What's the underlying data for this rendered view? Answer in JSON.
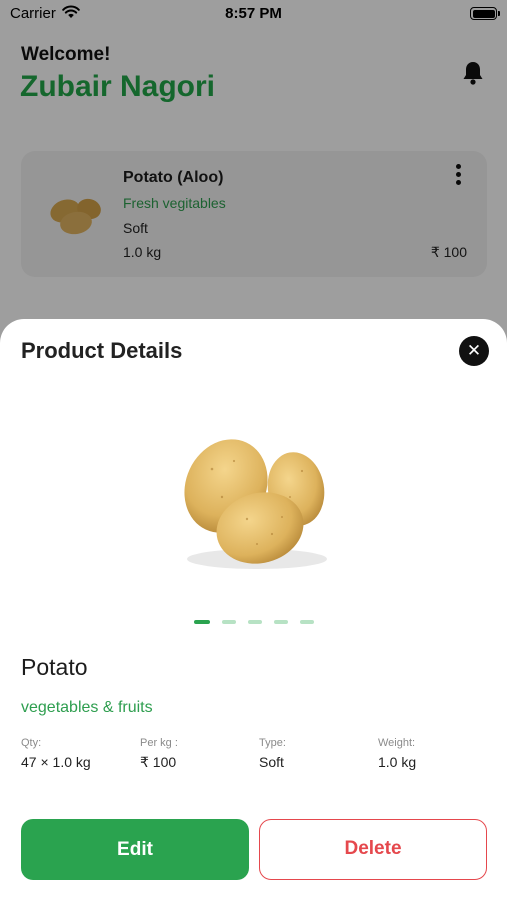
{
  "status_bar": {
    "carrier": "Carrier",
    "time": "8:57 PM"
  },
  "header": {
    "greeting": "Welcome!",
    "user_name": "Zubair Nagori",
    "notification_icon": "bell-icon"
  },
  "product_card": {
    "title": "Potato (Aloo)",
    "category": "Fresh vegitables",
    "type": "Soft",
    "weight": "1.0 kg",
    "price": "₹ 100",
    "menu_icon": "more-vertical-icon"
  },
  "details_sheet": {
    "title": "Product Details",
    "close_icon": "close-icon",
    "carousel": {
      "count": 5,
      "active_index": 0
    },
    "product_name": "Potato",
    "category": "vegetables & fruits",
    "details": [
      {
        "label": "Qty:",
        "value": "47 × 1.0 kg"
      },
      {
        "label": "Per kg :",
        "value": "₹ 100"
      },
      {
        "label": "Type:",
        "value": "Soft"
      },
      {
        "label": "Weight:",
        "value": "1.0 kg"
      }
    ],
    "edit_label": "Edit",
    "delete_label": "Delete"
  },
  "colors": {
    "brand_green": "#2aa34f",
    "delete_red": "#e5484d",
    "overlay": "rgba(0,0,0,0.38)"
  }
}
